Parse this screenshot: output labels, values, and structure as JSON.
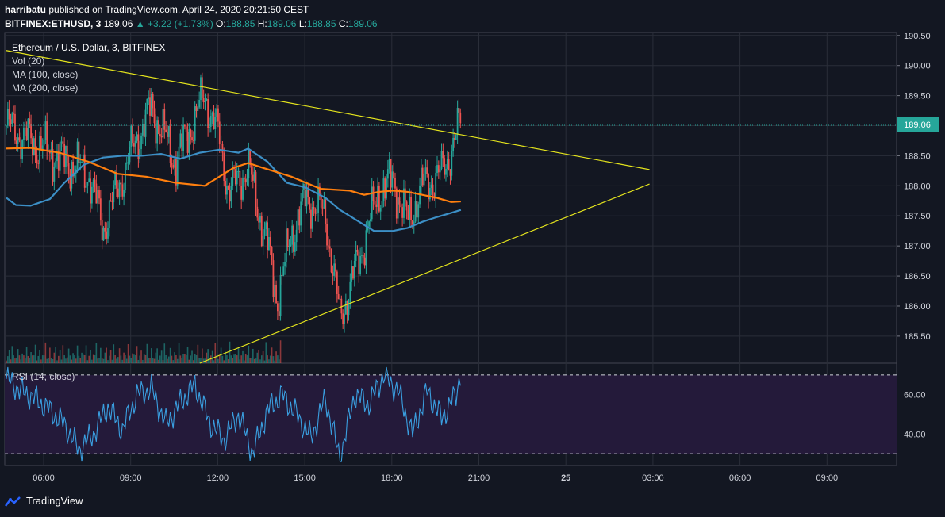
{
  "header": {
    "publisher": "harribatu",
    "published_text": "published on TradingView.com, April 24, 2020 20:21:50 CEST",
    "symbol": "BITFINEX:ETHUSD, 3",
    "last": "189.06",
    "change": "+3.22 (+1.73%)",
    "o_label": "O:",
    "o": "188.85",
    "h_label": "H:",
    "h": "189.06",
    "l_label": "L:",
    "l": "188.85",
    "c_label": "C:",
    "c": "189.06"
  },
  "legend": {
    "title": "Ethereum / U.S. Dollar, 3, BITFINEX",
    "vol": "Vol (20)",
    "ma100": "MA (100, close)",
    "ma200": "MA (200, close)",
    "rsi": "RSI (14, close)"
  },
  "footer": {
    "brand": "TradingView"
  },
  "colors": {
    "background": "#131722",
    "up": "#26a69a",
    "down": "#ef5350",
    "ma100": "#ff7f0e",
    "ma200": "#3c8fc6",
    "trendline": "#e4e41d",
    "rsi_line": "#3a9fe0",
    "rsi_band": "#241a3a",
    "price_tag": "#26a69a"
  },
  "chart_data": [
    {
      "type": "candlestick",
      "title": "Ethereum / U.S. Dollar, 3, BITFINEX",
      "ylim": [
        185.05,
        190.55
      ],
      "y_ticks": [
        190.5,
        190.0,
        189.5,
        189.0,
        188.5,
        188.0,
        187.5,
        187.0,
        186.5,
        186.0,
        185.5
      ],
      "y_tick_labels": [
        "190.50",
        "190.00",
        "189.50",
        "189.00",
        "188.50",
        "188.00",
        "187.50",
        "187.00",
        "186.50",
        "186.00",
        "185.50"
      ],
      "x_tick_labels": [
        "06:00",
        "09:00",
        "12:00",
        "15:00",
        "18:00",
        "21:00",
        "25",
        "03:00",
        "06:00",
        "09:00"
      ],
      "last_price_label": "189.06",
      "close_series": {
        "time": [
          "04:40",
          "06:00",
          "07:30",
          "08:00",
          "09:00",
          "09:40",
          "10:30",
          "11:30",
          "12:00",
          "12:20",
          "13:00",
          "13:40",
          "14:00",
          "14:30",
          "15:00",
          "15:40",
          "16:10",
          "16:50",
          "17:30",
          "18:00",
          "18:30",
          "19:00",
          "19:40",
          "20:00",
          "20:20"
        ],
        "close": [
          189.0,
          188.6,
          188.2,
          187.3,
          188.6,
          189.3,
          188.4,
          189.5,
          188.8,
          187.9,
          188.3,
          187.0,
          186.1,
          187.2,
          187.8,
          187.5,
          185.8,
          186.8,
          187.9,
          188.1,
          187.4,
          188.0,
          188.2,
          188.6,
          189.06
        ]
      },
      "ma100": {
        "time": [
          "04:40",
          "05:30",
          "06:30",
          "07:30",
          "08:30",
          "09:30",
          "10:30",
          "11:30",
          "12:30",
          "13:00",
          "13:30",
          "14:30",
          "15:30",
          "16:30",
          "17:00",
          "17:30",
          "18:00",
          "18:30",
          "19:00",
          "19:30",
          "20:00",
          "20:20"
        ],
        "value": [
          188.62,
          188.63,
          188.55,
          188.4,
          188.2,
          188.15,
          188.05,
          188.0,
          188.3,
          188.38,
          188.3,
          188.15,
          187.95,
          187.92,
          187.85,
          187.9,
          187.92,
          187.9,
          187.85,
          187.8,
          187.73,
          187.74
        ]
      },
      "ma200": {
        "time": [
          "04:40",
          "05:00",
          "05:30",
          "06:10",
          "06:40",
          "07:20",
          "08:00",
          "08:40",
          "09:20",
          "10:00",
          "10:40",
          "11:20",
          "12:00",
          "12:40",
          "13:00",
          "13:40",
          "14:20",
          "15:00",
          "15:40",
          "16:10",
          "16:40",
          "17:20",
          "18:00",
          "18:30",
          "19:00",
          "19:30",
          "20:00",
          "20:20"
        ],
        "value": [
          187.8,
          187.68,
          187.67,
          187.78,
          188.05,
          188.35,
          188.47,
          188.5,
          188.5,
          188.53,
          188.45,
          188.55,
          188.6,
          188.55,
          188.62,
          188.4,
          188.05,
          187.97,
          187.8,
          187.6,
          187.45,
          187.25,
          187.25,
          187.3,
          187.4,
          187.48,
          187.55,
          187.6
        ]
      },
      "trendlines": [
        {
          "label": "upper",
          "from": {
            "time": "04:40",
            "price": 190.25
          },
          "to": {
            "time": "02:50",
            "price": 188.27
          }
        },
        {
          "label": "lower",
          "from": {
            "time": "11:20",
            "price": 185.05
          },
          "to": {
            "time": "02:50",
            "price": 188.03
          }
        }
      ]
    },
    {
      "type": "line",
      "title": "RSI (14, close)",
      "ylim": [
        24,
        76
      ],
      "y_ticks": [
        60,
        40
      ],
      "y_tick_labels": [
        "60.00",
        "40.00"
      ],
      "band": [
        30,
        70
      ],
      "time": [
        "04:40",
        "05:10",
        "05:40",
        "06:10",
        "06:40",
        "07:10",
        "07:40",
        "08:10",
        "08:40",
        "09:10",
        "09:40",
        "10:10",
        "10:40",
        "11:10",
        "11:40",
        "12:10",
        "12:40",
        "13:10",
        "13:40",
        "14:10",
        "14:40",
        "15:10",
        "15:40",
        "16:10",
        "16:40",
        "17:10",
        "17:40",
        "18:10",
        "18:40",
        "19:10",
        "19:40",
        "20:10",
        "20:20"
      ],
      "values": [
        68,
        62,
        58,
        52,
        45,
        32,
        40,
        54,
        42,
        60,
        63,
        45,
        56,
        65,
        46,
        37,
        50,
        30,
        52,
        60,
        50,
        38,
        58,
        27,
        60,
        55,
        70,
        62,
        40,
        62,
        48,
        60,
        72
      ]
    },
    {
      "type": "bar",
      "title": "Vol (20)",
      "values": [
        2,
        3,
        5,
        2,
        9,
        3,
        2,
        4,
        6,
        3,
        2,
        5,
        3,
        2,
        12,
        3,
        2,
        6,
        4,
        3,
        8,
        2,
        3,
        5,
        2,
        4,
        3,
        9,
        3,
        2,
        6,
        3,
        2,
        4,
        7
      ]
    }
  ]
}
